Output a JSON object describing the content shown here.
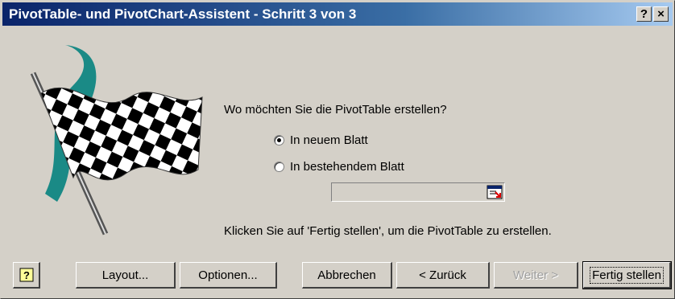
{
  "title": "PivotTable- und PivotChart-Assistent - Schritt 3 von 3",
  "titlebar_buttons": {
    "help": "?",
    "close": "×"
  },
  "question": "Wo möchten Sie die PivotTable erstellen?",
  "options": [
    {
      "label": "In neuem Blatt",
      "selected": true
    },
    {
      "label": "In bestehendem Blatt",
      "selected": false
    }
  ],
  "reference_value": "",
  "hint": "Klicken Sie auf 'Fertig stellen', um die PivotTable zu erstellen.",
  "buttons": {
    "layout": "Layout...",
    "options": "Optionen...",
    "cancel": "Abbrechen",
    "back": "< Zurück",
    "next": "Weiter >",
    "finish": "Fertig stellen"
  },
  "icons": {
    "help": "office-assistant-icon",
    "flag": "checkered-flag-icon",
    "ref": "collapse-dialog-icon"
  }
}
